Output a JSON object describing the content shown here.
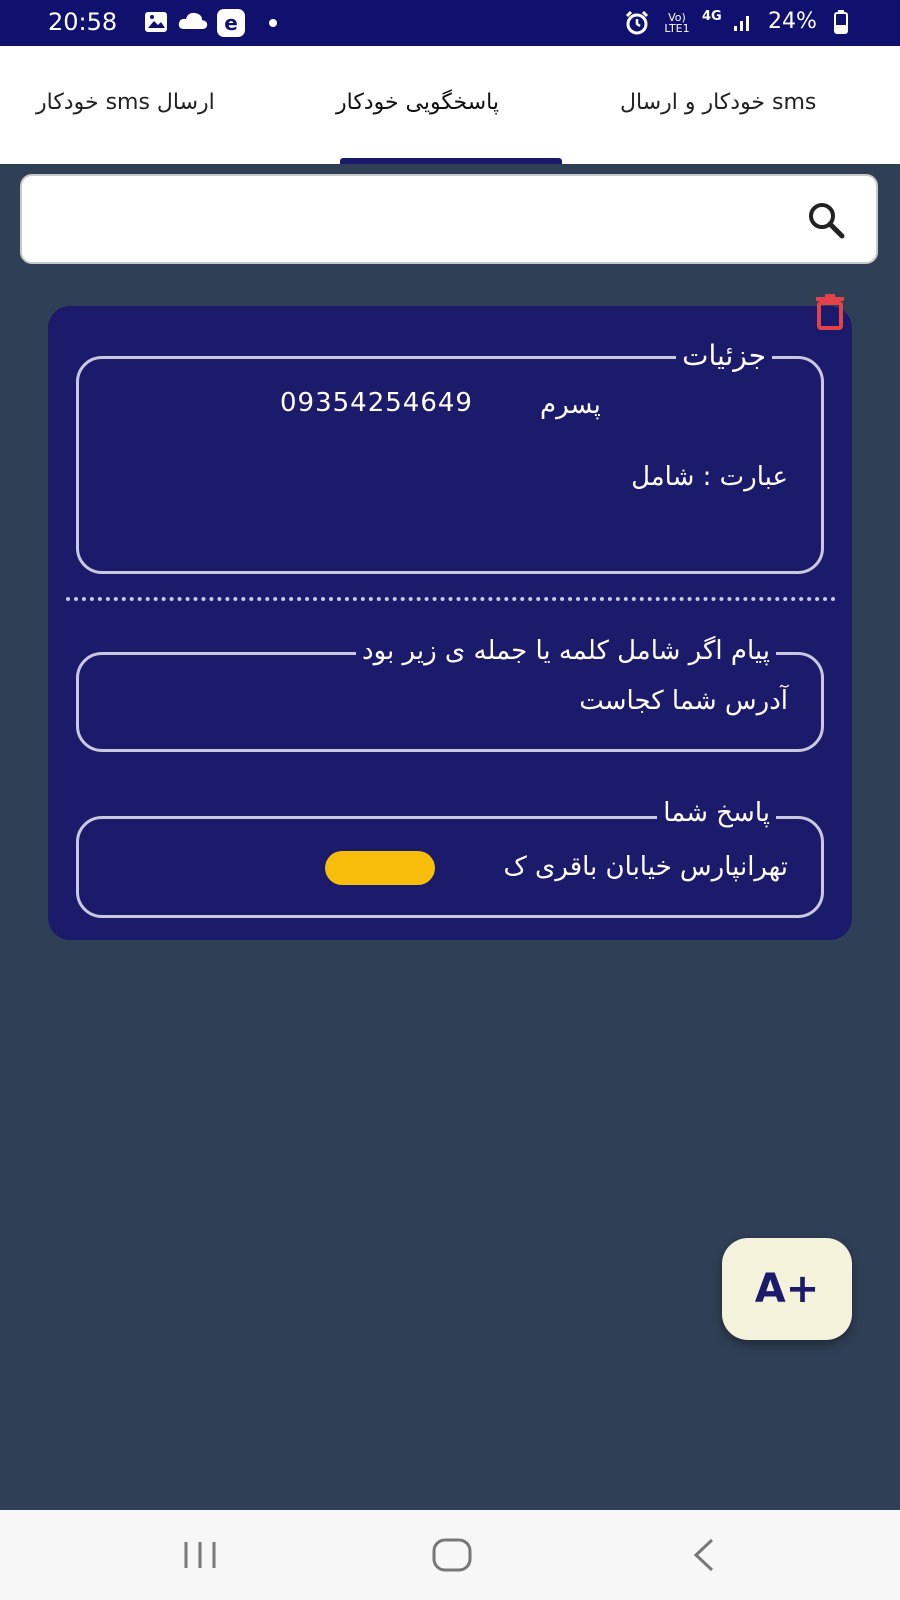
{
  "status_bar": {
    "time": "20:58",
    "network": "4G",
    "volte": "Vo) LTE1",
    "battery": "24%",
    "icons": [
      "gallery-icon",
      "cloud-icon",
      "browser-icon",
      "dot-icon",
      "alarm-icon",
      "signal-icon",
      "battery-icon"
    ]
  },
  "tabs": {
    "items": [
      {
        "label": "ارسال sms خودکار"
      },
      {
        "label": "پاسخگویی خودکار",
        "selected": true
      },
      {
        "label": "sms خودکار و ارسال"
      }
    ]
  },
  "search": {
    "placeholder": "",
    "icon": "search-icon"
  },
  "card": {
    "details": {
      "legend": "جزئیات",
      "contact_name": "پسرم",
      "contact_number": "09354254649",
      "condition": "عبارت : شامل"
    },
    "trigger": {
      "legend": "پیام اگر شامل کلمه یا جمله ی زیر بود",
      "value": "آدرس شما کجاست"
    },
    "reply": {
      "legend": "پاسخ شما",
      "value": "تهرانپارس خیابان باقری ک"
    }
  },
  "fab": {
    "label": "A+"
  },
  "colors": {
    "status_bar": "#10106e",
    "background": "#2f3f55",
    "card": "#1b1a6b",
    "delete": "#e2434b",
    "fab": "#f4f2db"
  }
}
